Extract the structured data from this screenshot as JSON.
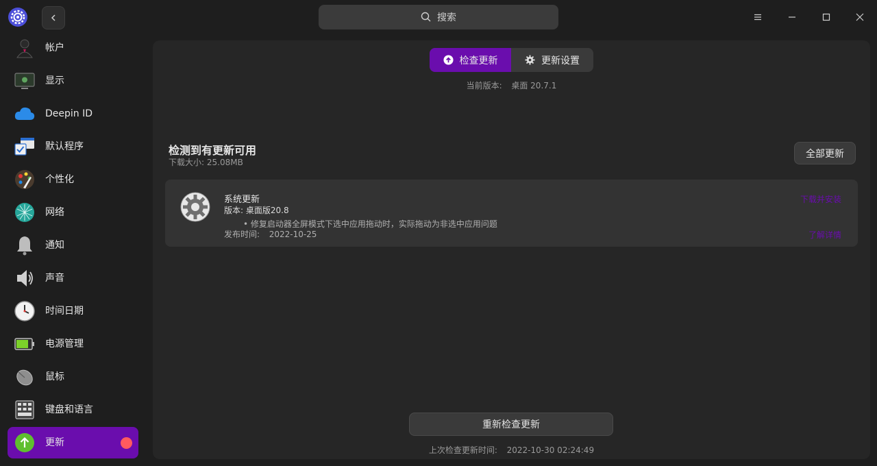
{
  "titlebar": {
    "search_placeholder": "搜索",
    "icons": [
      "app-logo-icon",
      "back-arrow-icon",
      "search-icon",
      "menu-icon",
      "minimize-icon",
      "maximize-icon",
      "close-icon"
    ]
  },
  "sidebar": {
    "items": [
      {
        "label": "帐户",
        "icon": "account-icon",
        "active": false
      },
      {
        "label": "显示",
        "icon": "display-icon",
        "active": false
      },
      {
        "label": "Deepin ID",
        "icon": "cloud-icon",
        "active": false
      },
      {
        "label": "默认程序",
        "icon": "default-apps-icon",
        "active": false
      },
      {
        "label": "个性化",
        "icon": "palette-icon",
        "active": false
      },
      {
        "label": "网络",
        "icon": "network-icon",
        "active": false
      },
      {
        "label": "通知",
        "icon": "bell-icon",
        "active": false
      },
      {
        "label": "声音",
        "icon": "speaker-icon",
        "active": false
      },
      {
        "label": "时间日期",
        "icon": "clock-icon",
        "active": false
      },
      {
        "label": "电源管理",
        "icon": "battery-icon",
        "active": false
      },
      {
        "label": "鼠标",
        "icon": "mouse-icon",
        "active": false
      },
      {
        "label": "键盘和语言",
        "icon": "keyboard-icon",
        "active": false
      },
      {
        "label": "更新",
        "icon": "update-icon",
        "active": true,
        "badge": true
      }
    ]
  },
  "main": {
    "tabs": [
      {
        "label": "检查更新",
        "icon": "upload-circle-icon",
        "active": true
      },
      {
        "label": "更新设置",
        "icon": "gear-icon",
        "active": false
      }
    ],
    "current_version_label": "当前版本:",
    "current_version_value": "桌面  20.7.1",
    "available_title": "检测到有更新可用",
    "download_size": "下载大小: 25.08MB",
    "update_all_label": "全部更新",
    "update_card": {
      "title": "系统更新",
      "version": "版本: 桌面版20.8",
      "note": "• 修复启动器全屏模式下选中应用拖动时，实际拖动为非选中应用问题",
      "release_label": "发布时间:",
      "release_date": "2022-10-25",
      "download_install_link": "下载并安装",
      "details_link": "了解详情"
    },
    "recheck_label": "重新检查更新",
    "last_check_label": "上次检查更新时间:",
    "last_check_value": "2022-10-30  02:24:49"
  },
  "colors": {
    "accent": "#6a0dad",
    "badge": "#ff5a5f",
    "background": "#1e1e1e",
    "panel": "#262626",
    "card": "#333333"
  }
}
